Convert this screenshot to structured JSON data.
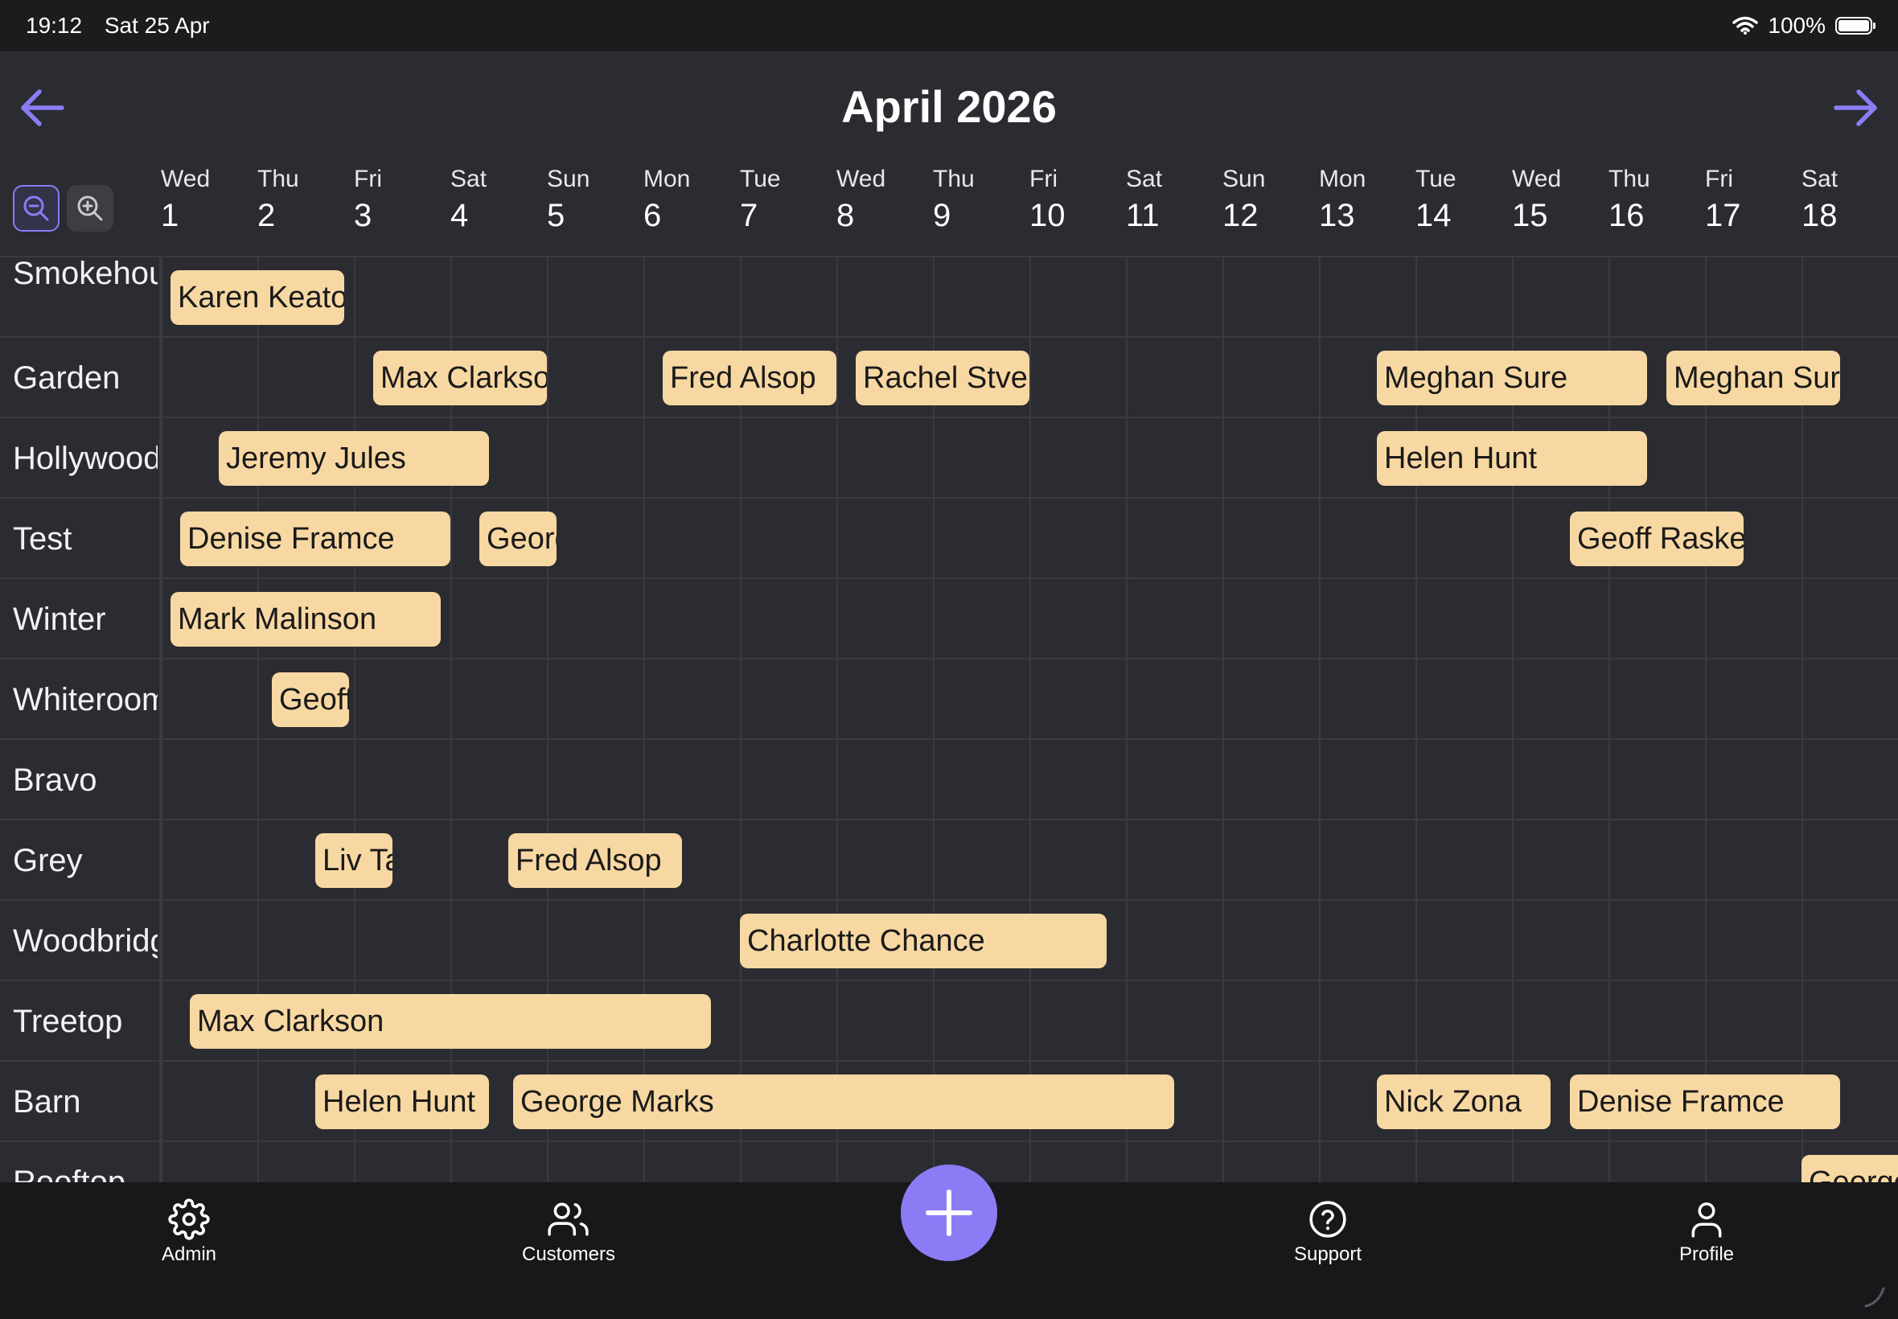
{
  "status": {
    "time": "19:12",
    "date": "Sat 25 Apr",
    "battery": "100%"
  },
  "header": {
    "title": "April 2026"
  },
  "days": [
    {
      "dow": "Wed",
      "num": "1"
    },
    {
      "dow": "Thu",
      "num": "2"
    },
    {
      "dow": "Fri",
      "num": "3"
    },
    {
      "dow": "Sat",
      "num": "4"
    },
    {
      "dow": "Sun",
      "num": "5"
    },
    {
      "dow": "Mon",
      "num": "6"
    },
    {
      "dow": "Tue",
      "num": "7"
    },
    {
      "dow": "Wed",
      "num": "8"
    },
    {
      "dow": "Thu",
      "num": "9"
    },
    {
      "dow": "Fri",
      "num": "10"
    },
    {
      "dow": "Sat",
      "num": "11"
    },
    {
      "dow": "Sun",
      "num": "12"
    },
    {
      "dow": "Mon",
      "num": "13"
    },
    {
      "dow": "Tue",
      "num": "14"
    },
    {
      "dow": "Wed",
      "num": "15"
    },
    {
      "dow": "Thu",
      "num": "16"
    },
    {
      "dow": "Fri",
      "num": "17"
    },
    {
      "dow": "Sat",
      "num": "18"
    }
  ],
  "rows": [
    {
      "label": "Smokehouse",
      "bookings": [
        {
          "name": "Karen Keaton",
          "start": 1.1,
          "end": 2.9
        }
      ]
    },
    {
      "label": "Garden",
      "bookings": [
        {
          "name": "Max Clarkson",
          "start": 3.2,
          "end": 5.0
        },
        {
          "name": "Fred Alsop",
          "start": 6.2,
          "end": 8.0
        },
        {
          "name": "Rachel Stverson",
          "start": 8.2,
          "end": 10.0
        },
        {
          "name": "Meghan Sure",
          "start": 13.6,
          "end": 16.4
        },
        {
          "name": "Meghan Sure",
          "start": 16.6,
          "end": 18.4
        }
      ]
    },
    {
      "label": "Hollywood",
      "bookings": [
        {
          "name": "Jeremy Jules",
          "start": 1.6,
          "end": 4.4
        },
        {
          "name": "Helen Hunt",
          "start": 13.6,
          "end": 16.4
        }
      ]
    },
    {
      "label": "Test",
      "bookings": [
        {
          "name": "Denise Framce",
          "start": 1.2,
          "end": 4.0
        },
        {
          "name": "George Marks",
          "start": 4.3,
          "end": 5.1
        },
        {
          "name": "Geoff Raske",
          "start": 15.6,
          "end": 17.4
        }
      ]
    },
    {
      "label": "Winter",
      "bookings": [
        {
          "name": "Mark Malinson",
          "start": 1.1,
          "end": 3.9
        }
      ]
    },
    {
      "label": "Whiteroom",
      "bookings": [
        {
          "name": "Geoff Raske",
          "start": 2.15,
          "end": 2.95
        }
      ]
    },
    {
      "label": "Bravo",
      "bookings": []
    },
    {
      "label": "Grey",
      "bookings": [
        {
          "name": "Liv Taylor",
          "start": 2.6,
          "end": 3.4
        },
        {
          "name": "Fred Alsop",
          "start": 4.6,
          "end": 6.4
        }
      ]
    },
    {
      "label": "Woodbridge",
      "bookings": [
        {
          "name": "Charlotte Chance",
          "start": 7.0,
          "end": 10.8
        }
      ]
    },
    {
      "label": "Treetop",
      "bookings": [
        {
          "name": "Max Clarkson",
          "start": 1.3,
          "end": 6.7
        }
      ]
    },
    {
      "label": "Barn",
      "bookings": [
        {
          "name": "Helen Hunt",
          "start": 2.6,
          "end": 4.4
        },
        {
          "name": "George Marks",
          "start": 4.65,
          "end": 11.5
        },
        {
          "name": "Nick Zona",
          "start": 13.6,
          "end": 15.4
        },
        {
          "name": "Denise Framce",
          "start": 15.6,
          "end": 18.4
        }
      ]
    },
    {
      "label": "Rooftop",
      "bookings": [
        {
          "name": "George Marks",
          "start": 18.0,
          "end": 19.5
        }
      ]
    }
  ],
  "tabs": {
    "admin": "Admin",
    "customers": "Customers",
    "support": "Support",
    "profile": "Profile"
  },
  "colors": {
    "accent": "#8b7cf6",
    "booking": "#f8d8a2",
    "background": "#2b2c31"
  }
}
